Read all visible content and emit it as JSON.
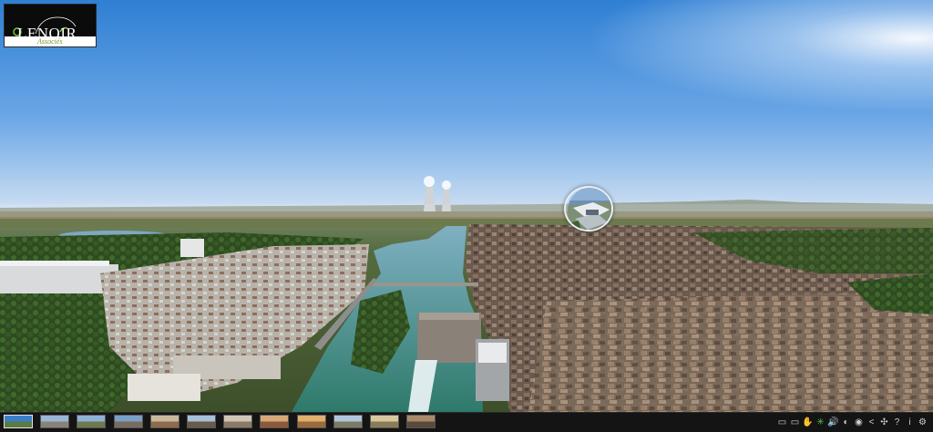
{
  "logo": {
    "top_text": "ARCHITECTES",
    "sub_text": "DESIGNERS",
    "name": "LENOIR",
    "script_text": "&",
    "signature": "Associés"
  },
  "panorama": {
    "hotspot_name": "aerial-view-hotspot"
  },
  "thumbnails": [
    {
      "name": "thumb-1",
      "active": true
    },
    {
      "name": "thumb-2",
      "active": false
    },
    {
      "name": "thumb-3",
      "active": false
    },
    {
      "name": "thumb-4",
      "active": false
    },
    {
      "name": "thumb-5",
      "active": false
    },
    {
      "name": "thumb-6",
      "active": false
    },
    {
      "name": "thumb-7",
      "active": false
    },
    {
      "name": "thumb-8",
      "active": false
    },
    {
      "name": "thumb-9",
      "active": false
    },
    {
      "name": "thumb-10",
      "active": false
    },
    {
      "name": "thumb-11",
      "active": false
    },
    {
      "name": "thumb-12",
      "active": false
    }
  ],
  "controls": [
    {
      "icon": "zoom-out-icon",
      "glyph": "▭"
    },
    {
      "icon": "zoom-in-icon",
      "glyph": "▭"
    },
    {
      "icon": "grab-hand-icon",
      "glyph": "✋"
    },
    {
      "icon": "autorotate-icon",
      "glyph": "✳",
      "color": "#4cc23a"
    },
    {
      "icon": "sound-icon",
      "glyph": "🔊",
      "color": "#4cc23a"
    },
    {
      "icon": "gyroscope-icon",
      "glyph": "◐"
    },
    {
      "icon": "vr-globe-icon",
      "glyph": "◉"
    },
    {
      "icon": "share-icon",
      "glyph": "<"
    },
    {
      "icon": "fullscreen-icon",
      "glyph": "✣"
    },
    {
      "icon": "help-icon",
      "glyph": "?"
    },
    {
      "icon": "info-icon",
      "glyph": "i"
    },
    {
      "icon": "settings-gear-icon",
      "glyph": "⚙"
    }
  ]
}
